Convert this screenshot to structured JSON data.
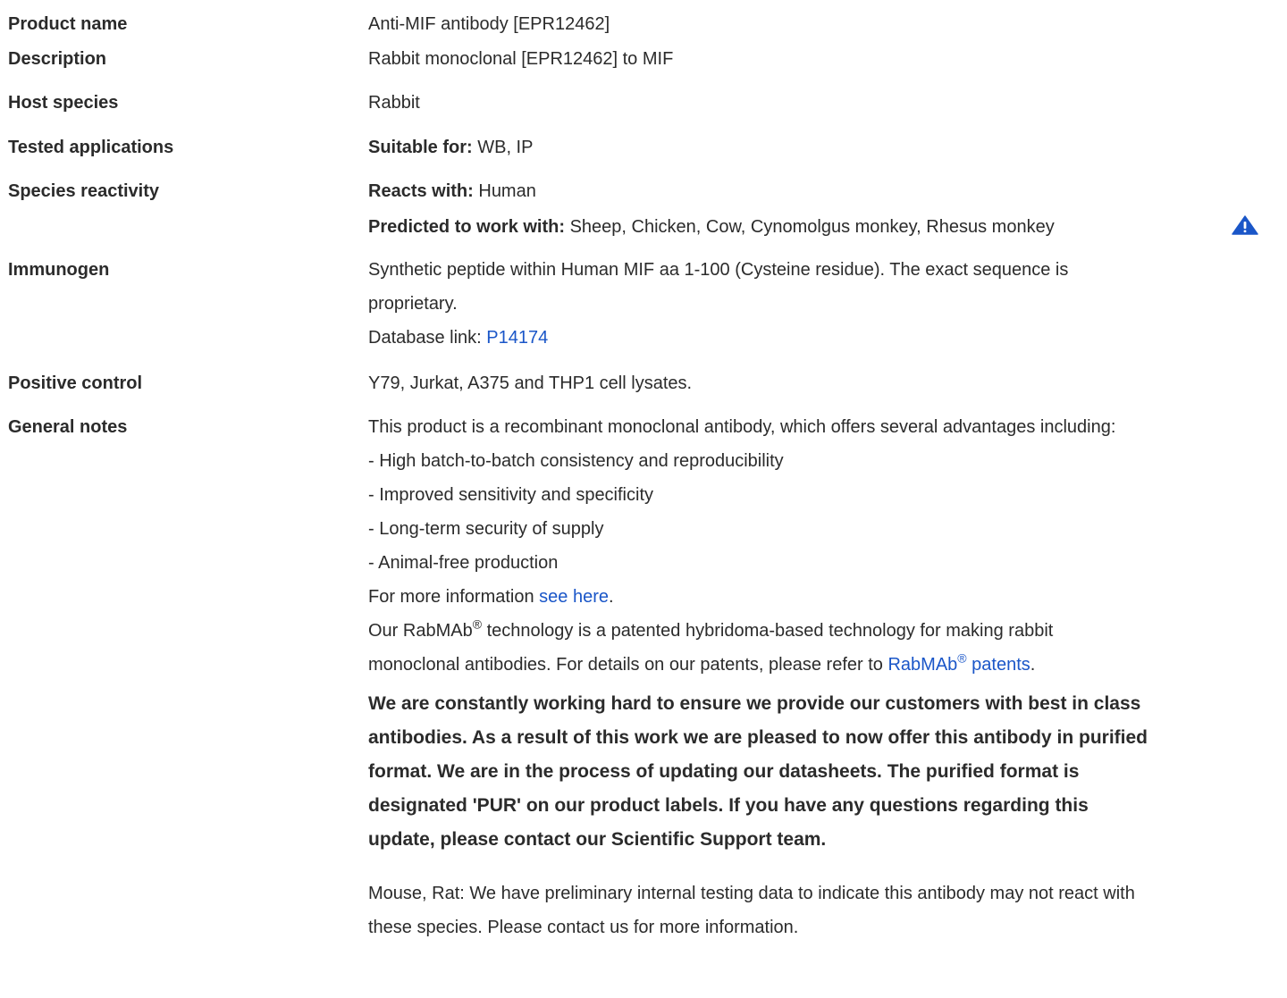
{
  "rows": {
    "product_name": {
      "label": "Product name",
      "value": "Anti-MIF antibody [EPR12462]"
    },
    "description": {
      "label": "Description",
      "value": "Rabbit monoclonal [EPR12462] to MIF"
    },
    "host_species": {
      "label": "Host species",
      "value": "Rabbit"
    },
    "tested_applications": {
      "label": "Tested applications",
      "prefix": "Suitable for:",
      "value": " WB, IP"
    },
    "species_reactivity": {
      "label": "Species reactivity",
      "reacts_prefix": "Reacts with:",
      "reacts_value": " Human",
      "predicted_prefix": "Predicted to work with:",
      "predicted_value": " Sheep, Chicken, Cow, Cynomolgus monkey, Rhesus monkey",
      "warning_icon": "warning-triangle-icon"
    },
    "immunogen": {
      "label": "Immunogen",
      "line1": "Synthetic peptide within Human MIF aa 1-100 (Cysteine residue). The exact sequence is",
      "line2": "proprietary.",
      "db_prefix": "Database link: ",
      "db_link": "P14174"
    },
    "positive_control": {
      "label": "Positive control",
      "value": "Y79, Jurkat, A375 and THP1 cell lysates."
    },
    "general_notes": {
      "label": "General notes",
      "intro": "This product is a recombinant monoclonal antibody, which offers several advantages including:",
      "bullets": [
        "- High batch-to-batch consistency and reproducibility",
        "- Improved sensitivity and specificity",
        "- Long-term security of supply",
        "- Animal-free production"
      ],
      "more_prefix": "For more information ",
      "more_link": "see here",
      "more_suffix": ".",
      "rabmab_a": "Our RabMAb",
      "rabmab_reg": "®",
      "rabmab_b": " technology is a patented hybridoma-based technology for making rabbit",
      "rabmab_c": "monoclonal antibodies. For details on our patents, please refer to ",
      "patents_link_a": "RabMAb",
      "patents_link_reg": "®",
      "patents_link_b": " patents",
      "patents_suffix": ".",
      "bold_lines": [
        "We are constantly working hard to ensure we provide our customers with best in class",
        "antibodies. As a result of this work we are pleased to now offer this antibody in purified",
        "format. We are in the process of updating our datasheets. The purified format is",
        "designated 'PUR' on our product labels. If you have any questions regarding this",
        "update, please contact our Scientific Support team."
      ],
      "mouse_line1": "Mouse, Rat: We have preliminary internal testing data to indicate this antibody may not react with",
      "mouse_line2": "these species. Please contact us for more information."
    }
  },
  "colors": {
    "link": "#1a56c8",
    "text": "#2b2b2b",
    "warning_icon": "#1a56c8"
  }
}
